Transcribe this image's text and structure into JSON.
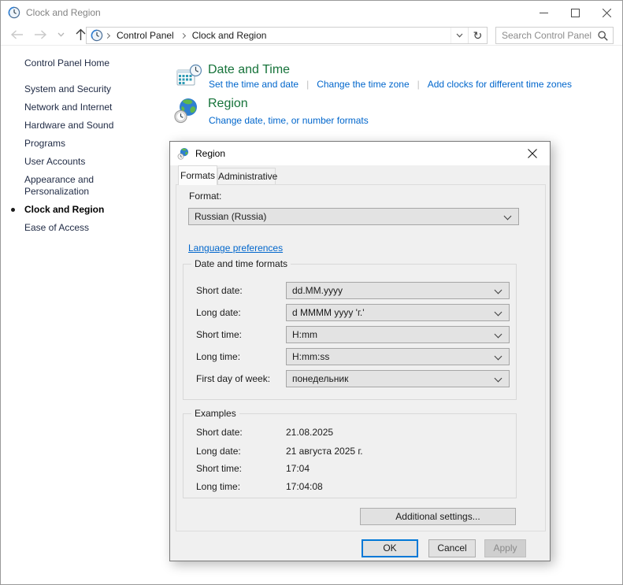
{
  "window": {
    "title": "Clock and Region"
  },
  "navbar": {
    "breadcrumb": [
      "Control Panel",
      "Clock and Region"
    ],
    "refresh_glyph": "↻",
    "search_placeholder": "Search Control Panel"
  },
  "sidebar": {
    "home": "Control Panel Home",
    "items": [
      {
        "label": "System and Security"
      },
      {
        "label": "Network and Internet"
      },
      {
        "label": "Hardware and Sound"
      },
      {
        "label": "Programs"
      },
      {
        "label": "User Accounts"
      },
      {
        "label": "Appearance and Personalization"
      },
      {
        "label": "Clock and Region",
        "active": true
      },
      {
        "label": "Ease of Access"
      }
    ]
  },
  "main": {
    "sections": [
      {
        "title": "Date and Time",
        "links": [
          "Set the time and date",
          "Change the time zone",
          "Add clocks for different time zones"
        ]
      },
      {
        "title": "Region",
        "links": [
          "Change date, time, or number formats"
        ]
      }
    ]
  },
  "dialog": {
    "title": "Region",
    "tabs": [
      {
        "label": "Formats"
      },
      {
        "label": "Administrative"
      }
    ],
    "format_label": "Format:",
    "format_value": "Russian (Russia)",
    "language_link": "Language preferences",
    "datetime_group": {
      "title": "Date and time formats",
      "rows": [
        {
          "label": "Short date:",
          "value": "dd.MM.yyyy"
        },
        {
          "label": "Long date:",
          "value": "d MMMM yyyy 'г.'"
        },
        {
          "label": "Short time:",
          "value": "H:mm"
        },
        {
          "label": "Long time:",
          "value": "H:mm:ss"
        },
        {
          "label": "First day of week:",
          "value": "понедельник"
        }
      ]
    },
    "examples_group": {
      "title": "Examples",
      "rows": [
        {
          "label": "Short date:",
          "value": "21.08.2025"
        },
        {
          "label": "Long date:",
          "value": "21 августа 2025 г."
        },
        {
          "label": "Short time:",
          "value": "17:04"
        },
        {
          "label": "Long time:",
          "value": "17:04:08"
        }
      ]
    },
    "buttons": {
      "additional": "Additional settings...",
      "ok": "OK",
      "cancel": "Cancel",
      "apply": "Apply"
    }
  },
  "colors": {
    "heading_green": "#16733a",
    "link_blue": "#0066cc",
    "accent_blue": "#0078d7",
    "dialog_bg": "#f0f0f0"
  }
}
